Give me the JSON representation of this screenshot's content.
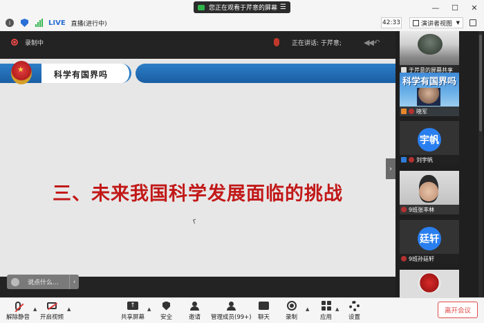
{
  "titlebar": {
    "share_notice": "您正在观看于芹意的屏幕",
    "menu_icon": "menu-lines-icon",
    "window_controls": [
      "minimize",
      "maximize",
      "close"
    ]
  },
  "statusbar": {
    "live_badge": "LIVE",
    "live_text": "直播(进行中)",
    "timer": "42:33",
    "view_mode": "演讲者视图"
  },
  "stage": {
    "recording_label": "录制中",
    "speaking_label": "正在讲话: 于芹意;"
  },
  "slide": {
    "banner_title": "科学有国界吗",
    "heading": "三、未来我国科学发展面临的挑战"
  },
  "chat_input": {
    "placeholder": "说点什么..."
  },
  "participants": [
    {
      "caption": "于芹意的屏幕共享",
      "icon": "screen-share-icon"
    },
    {
      "caption": "晓军",
      "tile_text": "科学有国界吗",
      "icon": "user-icon"
    },
    {
      "caption": "刘宇帆",
      "avatar_text": "宇帆",
      "icon": "user-icon"
    },
    {
      "caption": "9班张丰林",
      "icon": "mic-muted-icon"
    },
    {
      "caption": "9班孙廷轩",
      "avatar_text": "廷轩",
      "icon": "mic-muted-icon"
    },
    {
      "caption": "",
      "icon": "emblem-icon"
    }
  ],
  "toolbar": {
    "unmute": "解除静音",
    "start_video": "开启视频",
    "share_screen": "共享屏幕",
    "security": "安全",
    "invite": "邀请",
    "manage_members": "管理成员(99+)",
    "chat": "聊天",
    "record": "录制",
    "apps": "应用",
    "settings": "设置",
    "leave": "离开会议"
  },
  "colors": {
    "accent_red": "#e04b4b",
    "slide_heading": "#c21818",
    "banner_blue": "#2d7ec7",
    "avatar_blue": "#2a7ff0",
    "live_blue": "#2a6fd6"
  }
}
